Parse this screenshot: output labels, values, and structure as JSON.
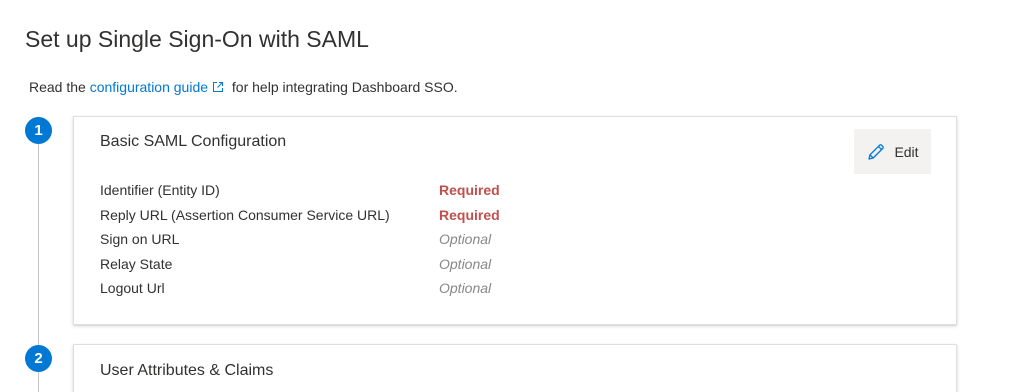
{
  "page": {
    "title": "Set up Single Sign-On with SAML"
  },
  "intro": {
    "prefix": "Read the ",
    "link_text": "configuration guide",
    "suffix": " for help integrating Dashboard SSO."
  },
  "steps": [
    {
      "number": "1",
      "title": "Basic SAML Configuration",
      "edit_label": "Edit",
      "fields": [
        {
          "label": "Identifier (Entity ID)",
          "status": "Required"
        },
        {
          "label": "Reply URL (Assertion Consumer Service URL)",
          "status": "Required"
        },
        {
          "label": "Sign on URL",
          "status": "Optional"
        },
        {
          "label": "Relay State",
          "status": "Optional"
        },
        {
          "label": "Logout Url",
          "status": "Optional"
        }
      ]
    },
    {
      "number": "2",
      "title": "User Attributes & Claims"
    }
  ],
  "icons": {
    "external_link": "external-link-icon",
    "edit": "pencil-icon"
  },
  "colors": {
    "accent": "#0078d4",
    "required": "#c0504d",
    "optional": "#8a8886"
  }
}
